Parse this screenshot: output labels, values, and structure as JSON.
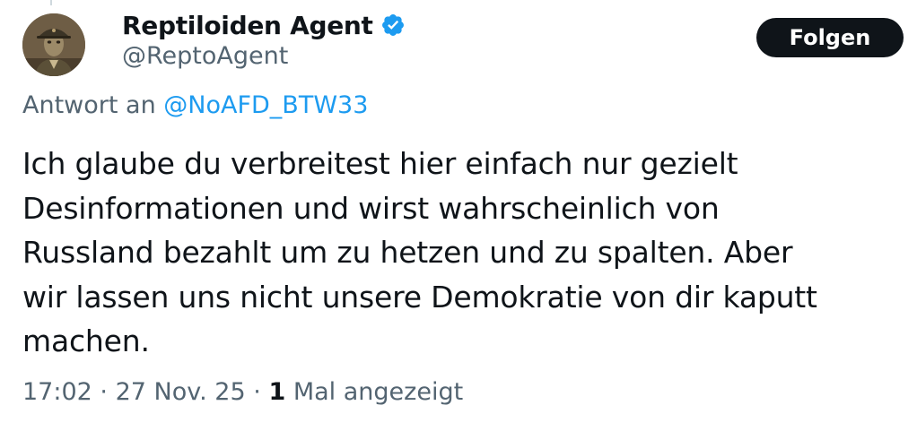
{
  "author": {
    "display_name": "Reptiloiden Agent",
    "handle": "@ReptoAgent",
    "verified": true,
    "verified_color": "#1d9bf0",
    "avatar_icon": "reptile-soldier-avatar"
  },
  "follow_button": {
    "label": "Folgen"
  },
  "reply": {
    "prefix": "Antwort an",
    "mention": "@NoAFD_BTW33",
    "mention_color": "#1d9bf0"
  },
  "tweet": {
    "lines": [
      "Ich glaube du verbreitest hier einfach nur gezielt",
      "Desinformationen und wirst wahrscheinlich von",
      "Russland bezahlt um zu hetzen und zu spalten. Aber",
      "wir lassen uns nicht unsere Demokratie von dir kaputt",
      "machen."
    ]
  },
  "meta": {
    "time": "17:02",
    "separator": "·",
    "date": "27 Nov. 25",
    "views_count": "1",
    "views_label": "Mal angezeigt"
  }
}
